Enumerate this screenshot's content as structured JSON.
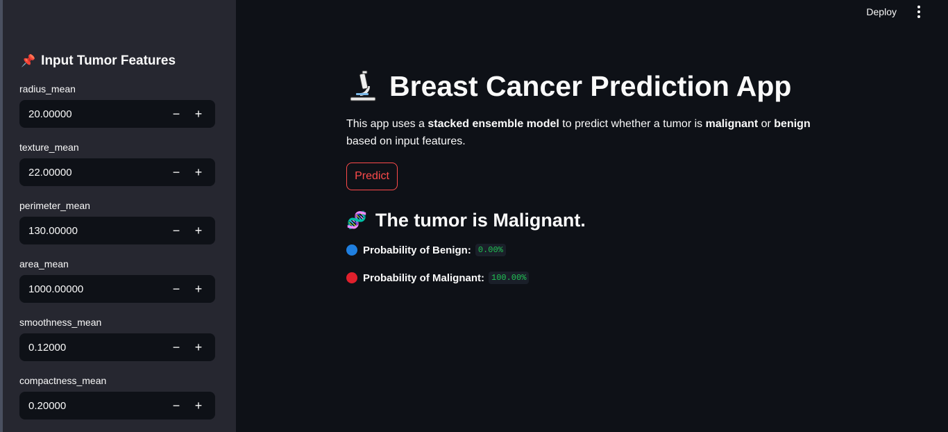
{
  "header": {
    "deploy_label": "Deploy",
    "menu_icon": "kebab-menu-icon"
  },
  "sidebar": {
    "title": "Input Tumor Features",
    "title_icon": "pushpin-icon",
    "fields": [
      {
        "label": "radius_mean",
        "value": "20.00000"
      },
      {
        "label": "texture_mean",
        "value": "22.00000"
      },
      {
        "label": "perimeter_mean",
        "value": "130.00000"
      },
      {
        "label": "area_mean",
        "value": "1000.00000"
      },
      {
        "label": "smoothness_mean",
        "value": "0.12000"
      },
      {
        "label": "compactness_mean",
        "value": "0.20000"
      }
    ],
    "minus": "−",
    "plus": "+"
  },
  "main": {
    "title": "Breast Cancer Prediction App",
    "title_icon": "microscope-icon",
    "desc": {
      "p1": "This app uses a ",
      "b1": "stacked ensemble model",
      "p2": " to predict whether a tumor is ",
      "b2": "malignant",
      "p3": " or ",
      "b3": "benign",
      "p4": " based on input features."
    },
    "predict_label": "Predict",
    "result_text": "The tumor is Malignant.",
    "result_icon": "dna-icon",
    "prob_benign_label": "Probability of Benign:",
    "prob_benign_value": "0.00%",
    "prob_malignant_label": "Probability of Malignant:",
    "prob_malignant_value": "100.00%"
  },
  "colors": {
    "accent": "#ff4b4b",
    "benign_dot": "#1f7fe0",
    "malignant_dot": "#e0202c",
    "code_green": "#21c354"
  }
}
